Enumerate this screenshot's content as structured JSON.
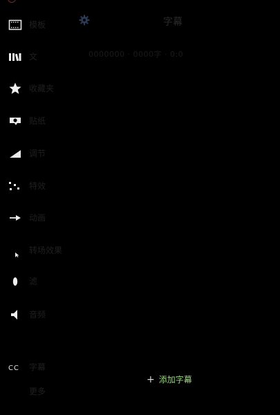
{
  "header": {
    "title": "字幕",
    "subtitle": "0000000 · 0000字 · 0:0"
  },
  "sidebar": {
    "items": [
      {
        "label": "模板",
        "icon": "film-frame-icon"
      },
      {
        "label": "文",
        "icon": "library-icon"
      },
      {
        "label": "收藏夹",
        "icon": "star-icon"
      },
      {
        "label": "贴纸",
        "icon": "sticker-icon"
      },
      {
        "label": "调节",
        "icon": "ramp-icon"
      },
      {
        "label": "特效",
        "icon": "dots-icon"
      },
      {
        "label": "动画",
        "icon": "arrow-right-icon"
      },
      {
        "label": "转场效果",
        "icon": "cursor-icon"
      },
      {
        "label": "滤",
        "icon": "drop-icon"
      },
      {
        "label": "音频",
        "icon": "speaker-icon"
      },
      {
        "label": "字幕",
        "icon": "cc-icon"
      },
      {
        "label": "更多",
        "icon": ""
      }
    ]
  },
  "actions": {
    "add_subtitle": "添加字幕",
    "add_icon": "plus-icon"
  },
  "colors": {
    "background": "#000000",
    "accent": "#9bd37f",
    "partial_icon": "#6d2a2a"
  }
}
